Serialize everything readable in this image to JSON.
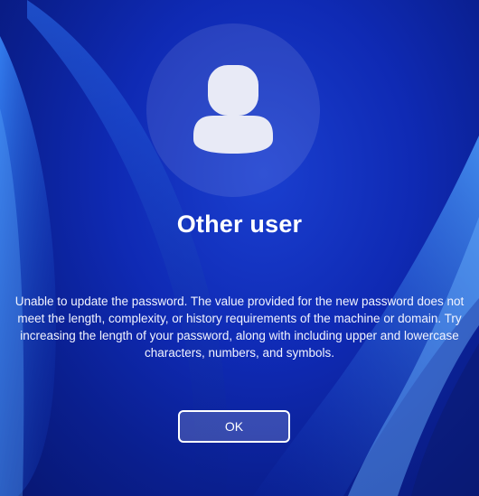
{
  "login": {
    "username": "Other user",
    "message": "Unable to update the password. The value provided for the new password does not meet the length, complexity, or history requirements of the machine or domain. Try increasing the length of your password, along with including upper and lowercase characters, numbers, and symbols.",
    "ok_label": "OK",
    "avatar_icon": "user-icon"
  },
  "colors": {
    "background": "#0f2ab4",
    "text": "#ffffff",
    "avatar_glyph": "#e8eaf6"
  }
}
